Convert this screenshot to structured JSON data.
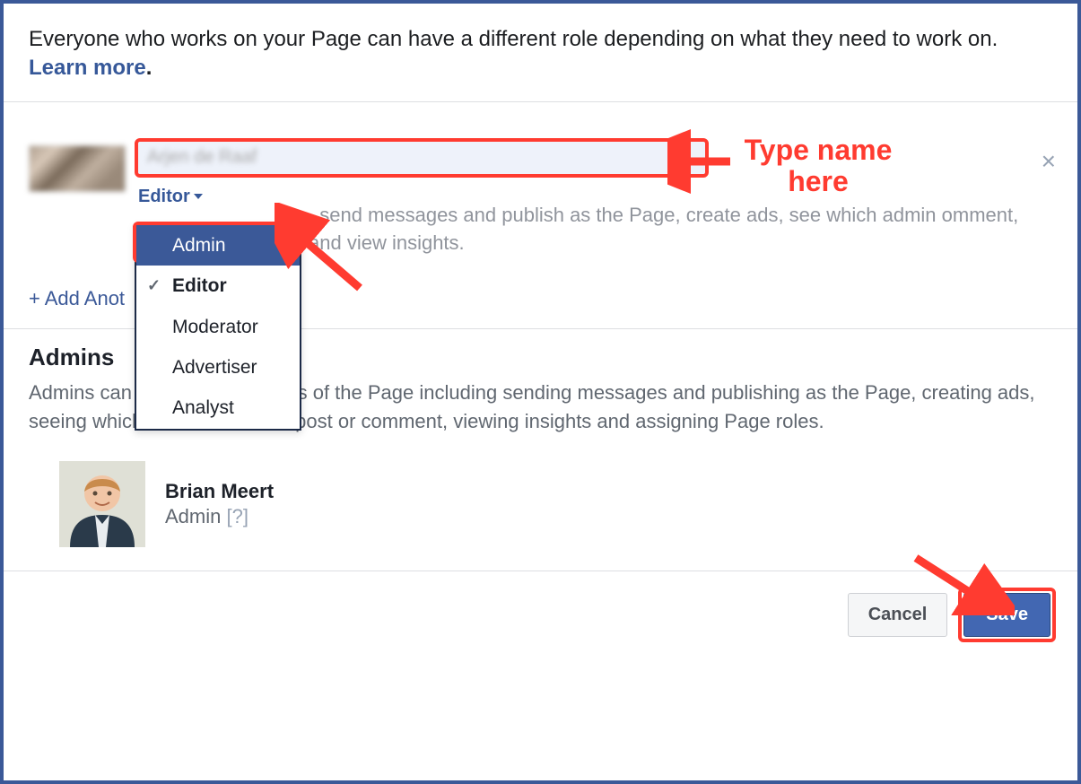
{
  "header": {
    "intro": "Everyone who works on your Page can have a different role depending on what they need to work on. ",
    "learn_more": "Learn more",
    "period": "."
  },
  "assign": {
    "name_input_blurred": "Arjen de Raaf",
    "role_label": "Editor",
    "role_description": ", send messages and publish as the Page, create ads, see which admin omment, and view insights.",
    "dropdown": {
      "options": [
        {
          "label": "Admin",
          "highlighted": true,
          "checked": false
        },
        {
          "label": "Editor",
          "highlighted": false,
          "checked": true,
          "bold": true
        },
        {
          "label": "Moderator",
          "highlighted": false,
          "checked": false
        },
        {
          "label": "Advertiser",
          "highlighted": false,
          "checked": false
        },
        {
          "label": "Analyst",
          "highlighted": false,
          "checked": false
        }
      ]
    },
    "add_another": "+ Add Anot",
    "close": "×"
  },
  "admins": {
    "heading": "Admins",
    "description": "Admins can manage all aspects of the Page including sending messages and publishing as the Page, creating ads, seeing which admin created a post or comment, viewing insights and assigning Page roles.",
    "entries": [
      {
        "name": "Brian Meert",
        "role": "Admin",
        "hint": "[?]"
      }
    ]
  },
  "footer": {
    "cancel": "Cancel",
    "save": "Save"
  },
  "annotations": {
    "type_name": "Type name here"
  }
}
